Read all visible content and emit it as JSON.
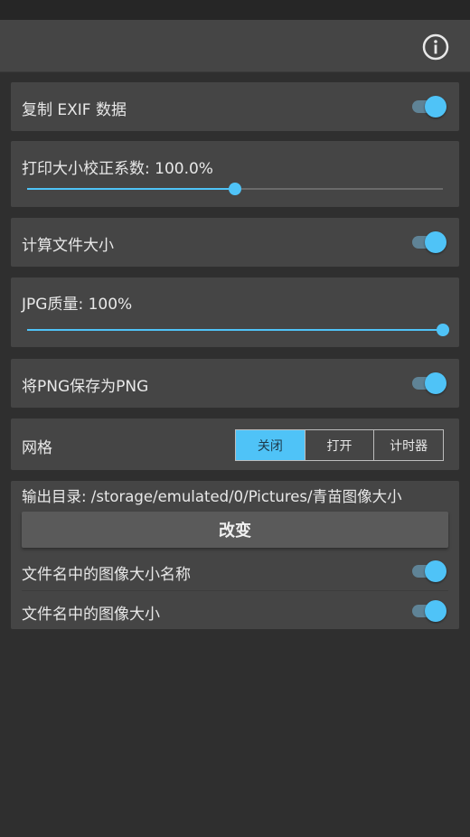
{
  "header": {
    "icon": "info-icon"
  },
  "settings": {
    "copy_exif": {
      "label": "复制 EXIF 数据",
      "enabled": true
    },
    "print_size": {
      "label": "打印大小校正系数: 100.0%",
      "slider_fraction": 0.5
    },
    "calc_size": {
      "label": "计算文件大小",
      "enabled": true
    },
    "jpg_quality": {
      "label": "JPG质量: 100%",
      "slider_fraction": 1.0
    },
    "save_png": {
      "label": "将PNG保存为PNG",
      "enabled": true
    },
    "grid": {
      "label": "网格",
      "options": [
        "关闭",
        "打开",
        "计时器"
      ],
      "selected": "关闭"
    },
    "output": {
      "label": "输出目录:  /storage/emulated/0/Pictures/青苗图像大小",
      "change_label": "改变",
      "name_in_filename": {
        "label": "文件名中的图像大小名称",
        "enabled": true
      },
      "size_in_filename": {
        "label": "文件名中的图像大小",
        "enabled": true
      }
    }
  },
  "colors": {
    "accent": "#4fc3f7",
    "card": "#454545",
    "background": "#2f2f2f"
  }
}
